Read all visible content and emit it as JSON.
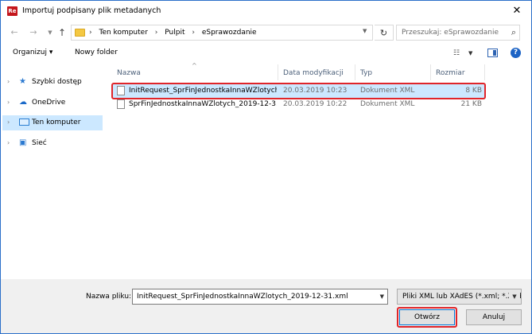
{
  "window": {
    "title": "Importuj podpisany plik metadanych",
    "app_icon_text": "Re",
    "close_glyph": "✕"
  },
  "address": {
    "crumbs": [
      "Ten komputer",
      "Pulpit",
      "eSprawozdanie"
    ],
    "separator": "›",
    "search_placeholder": "Przeszukaj: eSprawozdanie"
  },
  "toolbar": {
    "organize_label": "Organizuj ▾",
    "new_folder_label": "Nowy folder"
  },
  "nav_pane": {
    "items": [
      {
        "label": "Szybki dostęp",
        "icon": "star-icon"
      },
      {
        "label": "OneDrive",
        "icon": "cloud-icon"
      },
      {
        "label": "Ten komputer",
        "icon": "computer-icon",
        "selected": true
      },
      {
        "label": "Sieć",
        "icon": "network-icon"
      }
    ]
  },
  "columns": {
    "name": "Nazwa",
    "date": "Data modyfikacji",
    "type": "Typ",
    "size": "Rozmiar"
  },
  "files": [
    {
      "name": "InitRequest_SprFinJednostkaInnaWZlotych...",
      "date": "20.03.2019 10:23",
      "type": "Dokument XML",
      "size": "8 KB",
      "selected": true
    },
    {
      "name": "SprFinJednostkaInnaWZlotych_2019-12-3...",
      "date": "20.03.2019 10:22",
      "type": "Dokument XML",
      "size": "21 KB",
      "selected": false
    }
  ],
  "footer": {
    "filename_label": "Nazwa pliku:",
    "filename_value": "InitRequest_SprFinJednostkaInnaWZlotych_2019-12-31.xml",
    "filter_value": "Pliki XML lub XAdES (*.xml; *.Xades)",
    "open_label": "Otwórz",
    "cancel_label": "Anuluj"
  },
  "colors": {
    "accent": "#0078d7",
    "highlight_red": "#e0252a",
    "selection": "#cce8ff"
  }
}
